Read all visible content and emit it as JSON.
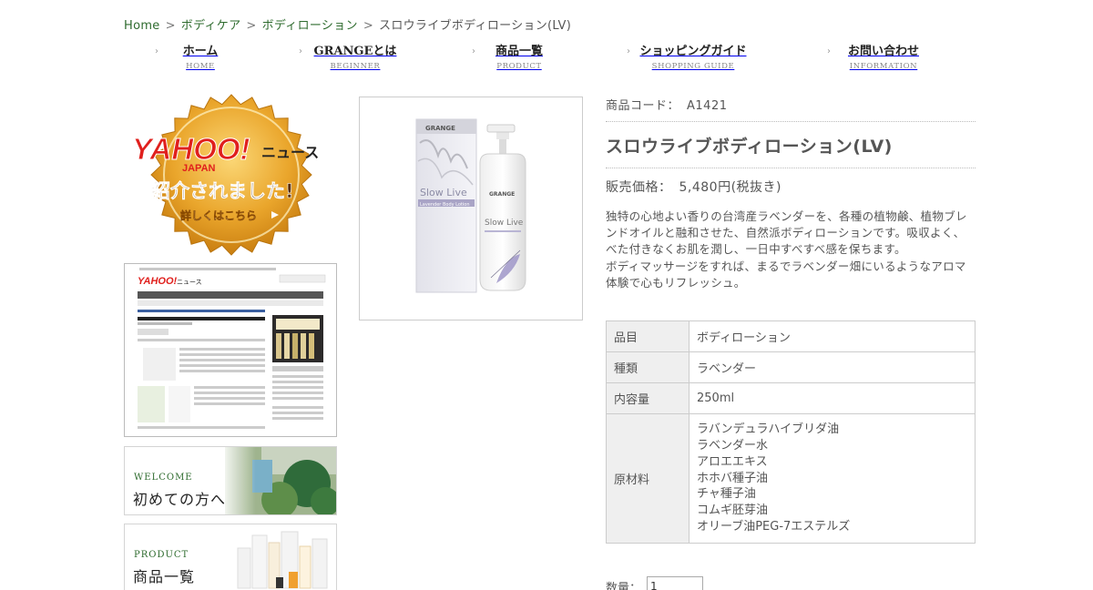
{
  "breadcrumb": {
    "items": [
      "Home",
      "ボディケア",
      "ボディローション"
    ],
    "separator": ">",
    "current": "スロウライブボディローション(LV)"
  },
  "gnav": [
    {
      "jp": "ホーム",
      "en": "HOME"
    },
    {
      "jp": "GRANGEとは",
      "en": "BEGINNER"
    },
    {
      "jp": "商品一覧",
      "en": "PRODUCT"
    },
    {
      "jp": "ショッピングガイド",
      "en": "SHOPPING GUIDE"
    },
    {
      "jp": "お問い合わせ",
      "en": "INFORMATION"
    }
  ],
  "sidebar": {
    "badge": {
      "brand": "YAHOO!",
      "brand_sub": "JAPAN",
      "news": "ニュース",
      "line1": "紹介されました!",
      "line2": "詳しくはこちら"
    },
    "news_shot": {
      "brand": "YAHOO!",
      "news": "ニュース"
    },
    "banners": [
      {
        "en": "WELCOME",
        "jp": "初めての方へ"
      },
      {
        "en": "PRODUCT",
        "jp": "商品一覧"
      }
    ]
  },
  "product": {
    "code_label": "商品コード：",
    "code": "A1421",
    "name": "スロウライブボディローション(LV)",
    "price_label": "販売価格：",
    "price": "5,480円(税抜き)",
    "description": [
      "独特の心地よい香りの台湾産ラベンダーを、各種の植物鹸、植物ブレンドオイルと融和させた、自然派ボディローションです。吸収よく、べた付きなくお肌を潤し、一日中すべすべ感を保ちます。",
      "ボディマッサージをすれば、まるでラベンダー畑にいるようなアロマ体験で心もリフレッシュ。"
    ],
    "package": {
      "brand": "GRANGE",
      "line": "Slow Live",
      "sub": "Lavender Body Lotion"
    }
  },
  "spec": [
    {
      "label": "品目",
      "values": [
        "ボディローション"
      ]
    },
    {
      "label": "種類",
      "values": [
        "ラベンダー"
      ]
    },
    {
      "label": "内容量",
      "values": [
        "250ml"
      ]
    },
    {
      "label": "原材料",
      "values": [
        "ラバンデュラハイブリダ油",
        "ラベンダー水",
        "アロエエキス",
        "ホホバ種子油",
        "チャ種子油",
        "コムギ胚芽油",
        "オリーブ油PEG-7エステルズ"
      ]
    }
  ],
  "quantity": {
    "label": "数量：",
    "value": "1"
  },
  "colors": {
    "link_green": "#2e6b2e",
    "badge_gold": "#e9a62b",
    "badge_red": "#e02020"
  }
}
